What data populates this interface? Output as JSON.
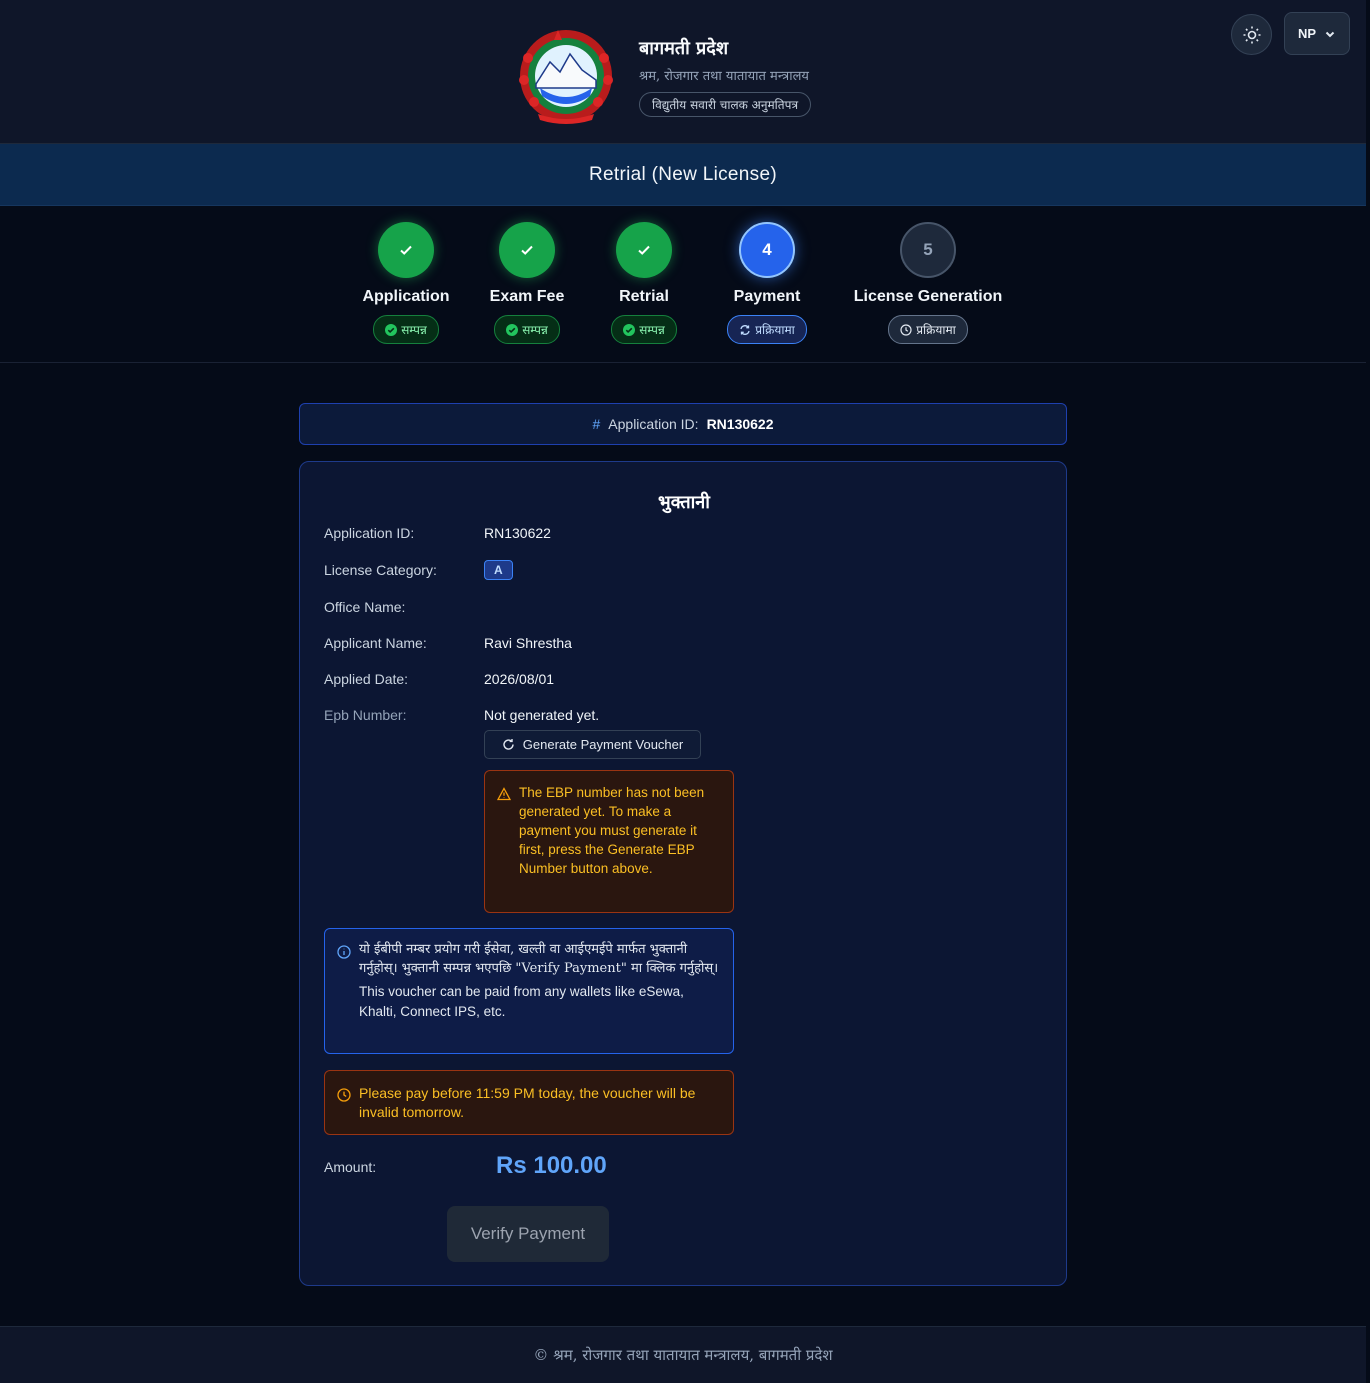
{
  "header": {
    "province_title": "बागमती प्रदेश",
    "ministry": "श्रम, रोजगार तथा यातायात मन्त्रालय",
    "system_badge": "विद्युतीय सवारी चालक अनुमतिपत्र",
    "language": "NP"
  },
  "page_title": "Retrial (New License)",
  "steps": [
    {
      "number": "1",
      "label": "Application",
      "status": "सम्पन्न",
      "state": "done"
    },
    {
      "number": "2",
      "label": "Exam Fee",
      "status": "सम्पन्न",
      "state": "done"
    },
    {
      "number": "3",
      "label": "Retrial",
      "status": "सम्पन्न",
      "state": "done"
    },
    {
      "number": "4",
      "label": "Payment",
      "status": "प्रक्रियामा",
      "state": "active"
    },
    {
      "number": "5",
      "label": "License Generation",
      "status": "प्रक्रियामा",
      "state": "pending"
    }
  ],
  "appid_bar": {
    "hash": "#",
    "label": "Application ID:",
    "value": "RN130622"
  },
  "card": {
    "title": "भुक्तानी",
    "rows": {
      "application_id": {
        "label": "Application ID:",
        "value": "RN130622"
      },
      "license_category": {
        "label": "License Category:",
        "value": "A"
      },
      "office_name": {
        "label": "Office Name:",
        "value": ""
      },
      "applicant_name": {
        "label": "Applicant Name:",
        "value": "Ravi Shrestha"
      },
      "applied_date": {
        "label": "Applied Date:",
        "value": "2026/08/01"
      },
      "epb_number": {
        "label": "Epb Number:",
        "value": "Not generated yet."
      }
    },
    "generate_button": "Generate Payment Voucher",
    "warning": "The EBP number has not been generated yet. To make a payment you must generate it first, press the Generate EBP Number button above.",
    "info_np": "यो ईबीपी नम्बर प्रयोग गरी ईसेवा, खल्ती वा आईएमईपे मार्फत भुक्तानी गर्नुहोस्। भुक्तानी सम्पन्न भएपछि \"Verify Payment\" मा क्लिक गर्नुहोस्।",
    "info_en": "This voucher can be paid from any wallets like eSewa, Khalti, Connect IPS, etc.",
    "deadline": "Please pay before 11:59 PM today, the voucher will be invalid tomorrow.",
    "amount_label": "Amount:",
    "amount_value": "Rs 100.00",
    "verify_button": "Verify Payment"
  },
  "footer": "© श्रम, रोजगार तथा यातायात मन्त्रालय, बागमती प्रदेश",
  "colors": {
    "background": "#050b18",
    "accent": "#2563eb",
    "success": "#16a34a",
    "warning": "#f59e0b",
    "amount": "#60a5fa"
  }
}
